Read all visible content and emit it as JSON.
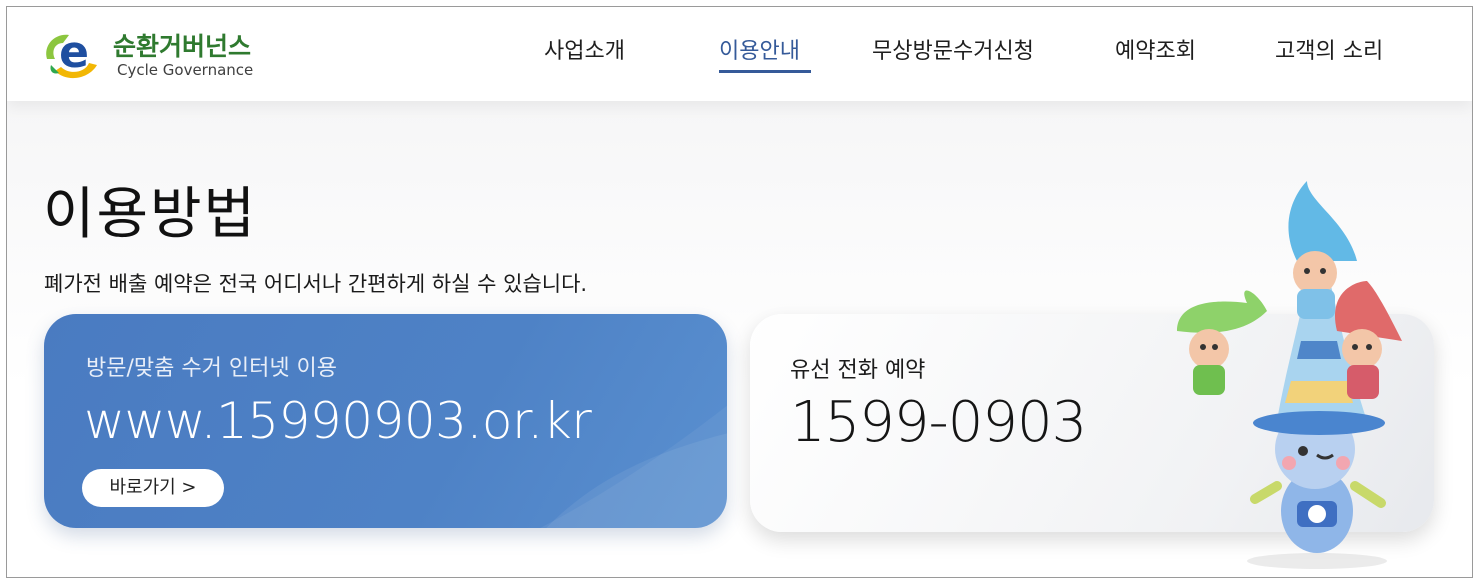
{
  "brand": {
    "name": "순환거버넌스",
    "subtitle": "Cycle Governance",
    "mark_letter": "e"
  },
  "nav": {
    "items": [
      {
        "label": "사업소개"
      },
      {
        "label": "이용안내"
      },
      {
        "label": "무상방문수거신청"
      },
      {
        "label": "예약조회"
      },
      {
        "label": "고객의 소리"
      }
    ],
    "active_index": 1,
    "active_color": "#355a99"
  },
  "page": {
    "title": "이용방법",
    "description": "폐가전 배출 예약은 전국 어디서나 간편하게 하실 수 있습니다."
  },
  "cards": {
    "web": {
      "label": "방문/맞춤 수거 인터넷 이용",
      "value": "www.15990903.or.kr",
      "button_label": "바로가기 >",
      "color": "#4a7bc1"
    },
    "phone": {
      "label": "유선 전화 예약",
      "value": "1599-0903"
    }
  },
  "icons": {
    "logo": "recycle-e-logo-icon",
    "mascots": "recycling-mascot-characters"
  }
}
